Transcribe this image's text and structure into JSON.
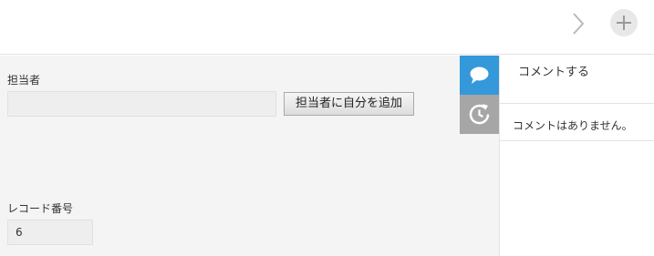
{
  "toolbar": {
    "next_icon": "chevron-right-icon",
    "add_icon": "plus-icon"
  },
  "form": {
    "assignee": {
      "label": "担当者",
      "value": "",
      "assign_self_label": "担当者に自分を追加"
    },
    "record_number": {
      "label": "レコード番号",
      "value": "6"
    }
  },
  "side_tabs": [
    {
      "icon": "speech-bubble-icon",
      "active": true
    },
    {
      "icon": "history-icon",
      "active": false
    }
  ],
  "comments": {
    "post_label": "コメントする",
    "empty_message": "コメントはありません。"
  },
  "colors": {
    "accent": "#3498db",
    "inactive_tab": "#a6a6a6",
    "form_background": "#f4f4f4"
  }
}
